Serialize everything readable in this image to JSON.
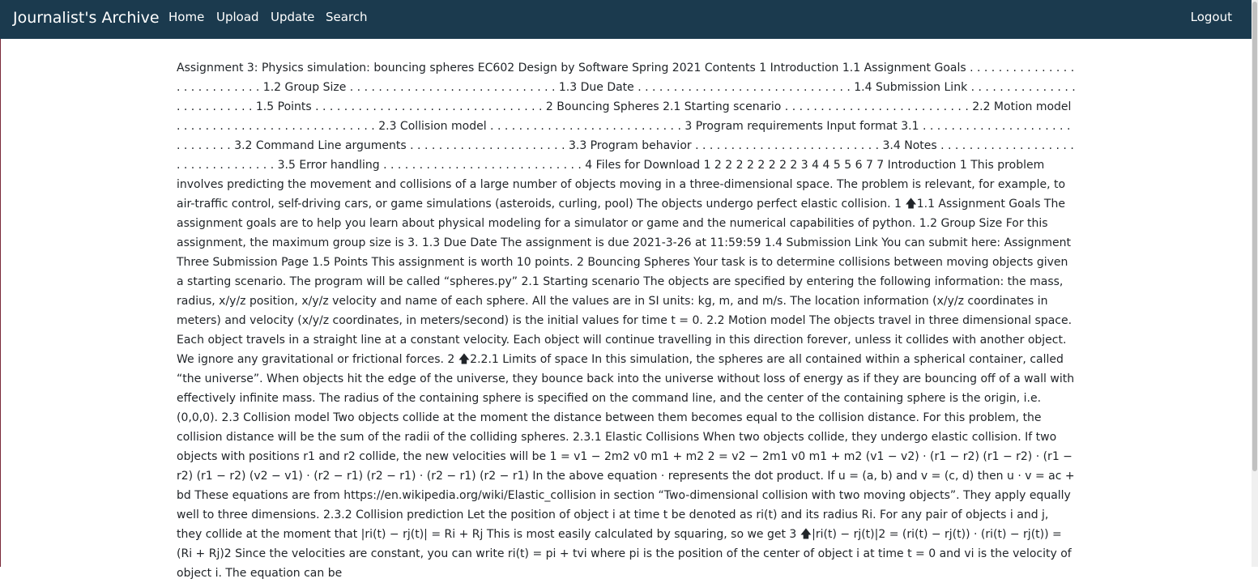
{
  "nav": {
    "brand": "Journalist's Archive",
    "home": "Home",
    "upload": "Upload",
    "update": "Update",
    "search": "Search",
    "logout": "Logout"
  },
  "document": {
    "text": "Assignment 3: Physics simulation: bouncing spheres EC602 Design by Software Spring 2021 Contents 1 Introduction 1.1 Assignment Goals . . . . . . . . . . . . . . . . . . . . . . . . . . . 1.2 Group Size . . . . . . . . . . . . . . . . . . . . . . . . . . . . . 1.3 Due Date . . . . . . . . . . . . . . . . . . . . . . . . . . . . . . 1.4 Submission Link . . . . . . . . . . . . . . . . . . . . . . . . . . 1.5 Points . . . . . . . . . . . . . . . . . . . . . . . . . . . . . . . . 2 Bouncing Spheres 2.1 Starting scenario . . . . . . . . . . . . . . . . . . . . . . . . . . 2.2 Motion model . . . . . . . . . . . . . . . . . . . . . . . . . . . . 2.3 Collision model . . . . . . . . . . . . . . . . . . . . . . . . . . . 3 Program requirements Input format 3.1 . . . . . . . . . . . . . . . . . . . . . . . . . . . . . 3.2 Command Line arguments . . . . . . . . . . . . . . . . . . . . . . 3.3 Program behavior . . . . . . . . . . . . . . . . . . . . . . . . . . 3.4 Notes . . . . . . . . . . . . . . . . . . . . . . . . . . . . . . . . . 3.5 Error handling . . . . . . . . . . . . . . . . . . . . . . . . . . . . 4 Files for Download 1 2 2 2 2 2 2 2 2 3 4 4 5 5 6 7 7 Introduction 1 This problem involves predicting the movement and collisions of a large number of objects moving in a three-dimensional space. The problem is relevant, for example, to air-traffic control, self-driving cars, or game simulations (asteroids, curling, pool) The objects undergo perfect elastic collision. 1 🡅1.1 Assignment Goals The assignment goals are to help you learn about physical modeling for a simulator or game and the numerical capabilities of python. 1.2 Group Size For this assignment, the maximum group size is 3. 1.3 Due Date The assignment is due 2021-3-26 at 11:59:59 1.4 Submission Link You can submit here: Assignment Three Submission Page 1.5 Points This assignment is worth 10 points. 2 Bouncing Spheres Your task is to determine collisions between moving objects given a starting scenario. The program will be called “spheres.py” 2.1 Starting scenario The objects are specified by entering the following information: the mass, radius, x/y/z position, x/y/z velocity and name of each sphere. All the values are in SI units: kg, m, and m/s. The location information (x/y/z coordinates in meters) and velocity (x/y/z coordinates, in meters/second) is the initial values for time t = 0. 2.2 Motion model The objects travel in three dimensional space. Each object travels in a straight line at a constant velocity. Each object will continue travelling in this direction forever, unless it collides with another object. We ignore any gravitational or frictional forces. 2 🡅2.2.1 Limits of space In this simulation, the spheres are all contained within a spherical container, called “the universe”. When objects hit the edge of the universe, they bounce back into the universe without loss of energy as if they are bouncing off of a wall with effectively infinite mass. The radius of the containing sphere is specified on the command line, and the center of the containing sphere is the origin, i.e. (0,0,0). 2.3 Collision model Two objects collide at the moment the distance between them becomes equal to the collision distance. For this problem, the collision distance will be the sum of the radii of the colliding spheres. 2.3.1 Elastic Collisions When two objects collide, they undergo elastic collision. If two objects with positions r1 and r2 collide, the new velocities will be 1 = v1 − 2m2 v0 m1 + m2 2 = v2 − 2m1 v0 m1 + m2 (v1 − v2) · (r1 − r2) (r1 − r2) · (r1 − r2) (r1 − r2) (v2 − v1) · (r2 − r1) (r2 − r1) · (r2 − r1) (r2 − r1) In the above equation · represents the dot product. If u = (a, b) and v = (c, d) then u · v = ac + bd These equations are from https://en.wikipedia.org/wiki/Elastic_collision in section “Two-dimensional collision with two moving objects”. They apply equally well to three dimensions. 2.3.2 Collision prediction Let the position of object i at time t be denoted as ri(t) and its radius Ri. For any pair of objects i and j, they collide at the moment that |ri(t) − rj(t)| = Ri + Rj This is most easily calculated by squaring, so we get 3 🡅|ri(t) − rj(t)|2 = (ri(t) − rj(t)) · (ri(t) − rj(t)) = (Ri + Rj)2 Since the velocities are constant, you can write ri(t) = pi + tvi where pi is the position of the center of object i at time t = 0 and vi is the velocity of object i. The equation can be"
  }
}
